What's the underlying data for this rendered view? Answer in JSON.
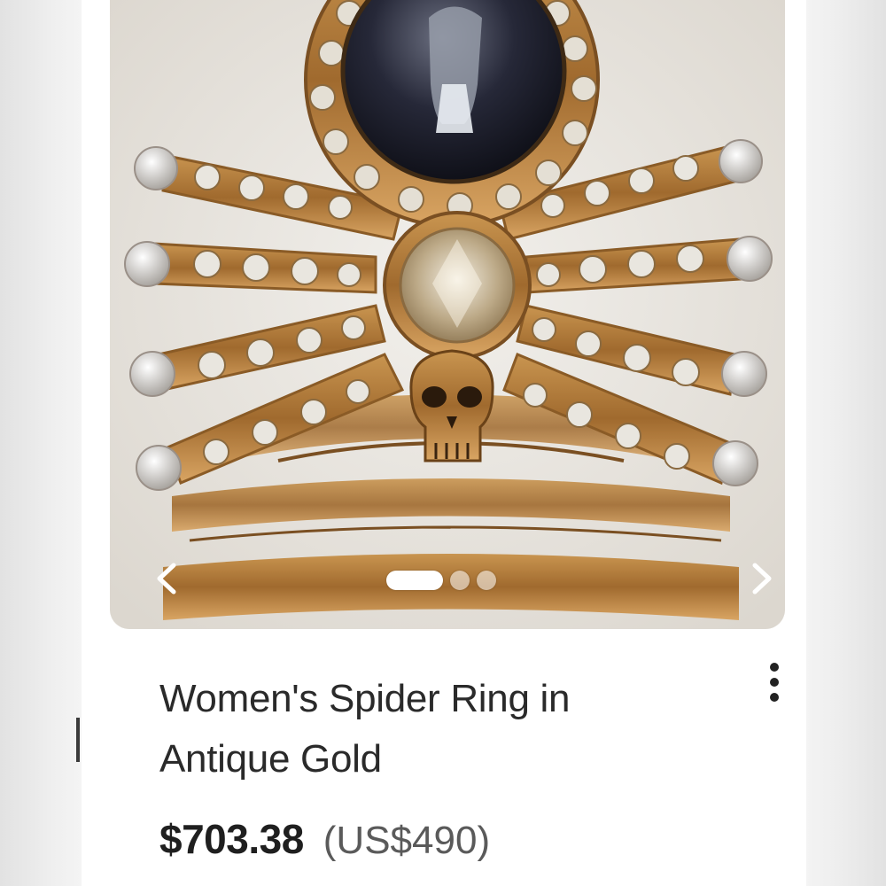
{
  "product": {
    "image_alt": "Spider ring with skull and crystals",
    "title": "Women's Spider Ring in Antique Gold",
    "price": "$703.38",
    "price_usd": "(US$490)"
  },
  "carousel": {
    "prev_icon": "chevron-left-icon",
    "next_icon": "chevron-right-icon",
    "dots": [
      {
        "active": true
      },
      {
        "active": false
      },
      {
        "active": false
      }
    ]
  },
  "menu": {
    "icon": "more-vertical-icon"
  },
  "colors": {
    "gold": "#b07a3a",
    "gold_light": "#d7a866",
    "stone_dark": "#1d1f2c",
    "background": "#e9e6e1"
  }
}
